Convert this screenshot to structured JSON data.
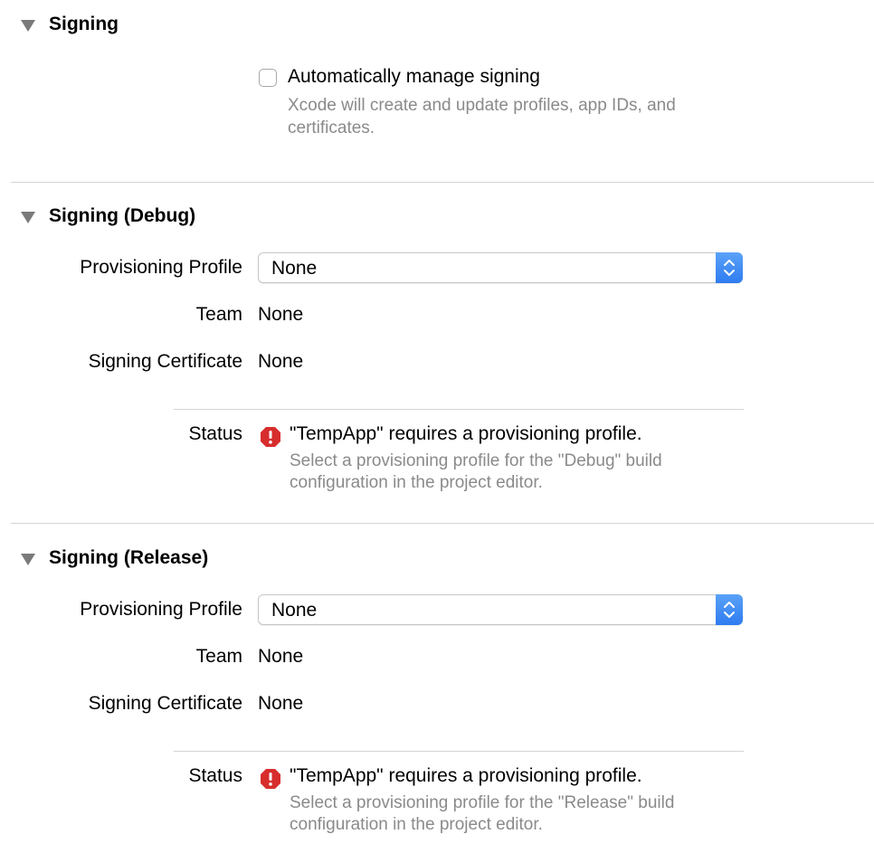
{
  "signing": {
    "title": "Signing",
    "auto_manage_label": "Automatically manage signing",
    "auto_manage_checked": false,
    "auto_manage_hint": "Xcode will create and update profiles, app IDs, and certificates."
  },
  "debug": {
    "title": "Signing (Debug)",
    "profile_label": "Provisioning Profile",
    "profile_value": "None",
    "team_label": "Team",
    "team_value": "None",
    "cert_label": "Signing Certificate",
    "cert_value": "None",
    "status_label": "Status",
    "status_message": "\"TempApp\" requires a provisioning profile.",
    "status_hint_line1": "Select a provisioning profile for the \"Debug\" build",
    "status_hint_line2": "configuration in the project editor."
  },
  "release": {
    "title": "Signing (Release)",
    "profile_label": "Provisioning Profile",
    "profile_value": "None",
    "team_label": "Team",
    "team_value": "None",
    "cert_label": "Signing Certificate",
    "cert_value": "None",
    "status_label": "Status",
    "status_message": "\"TempApp\" requires a provisioning profile.",
    "status_hint_line1": "Select a provisioning profile for the \"Release\" build",
    "status_hint_line2": "configuration in the project editor."
  },
  "icons": {
    "disclosure": "disclosure-triangle-down-icon",
    "error": "error-octagon-icon",
    "stepper": "popup-stepper-chevron-icon"
  },
  "colors": {
    "accent": "#2f7cf0",
    "error": "#d72d2d",
    "hint": "#8a8a8a",
    "divider": "#d4d4d4"
  }
}
